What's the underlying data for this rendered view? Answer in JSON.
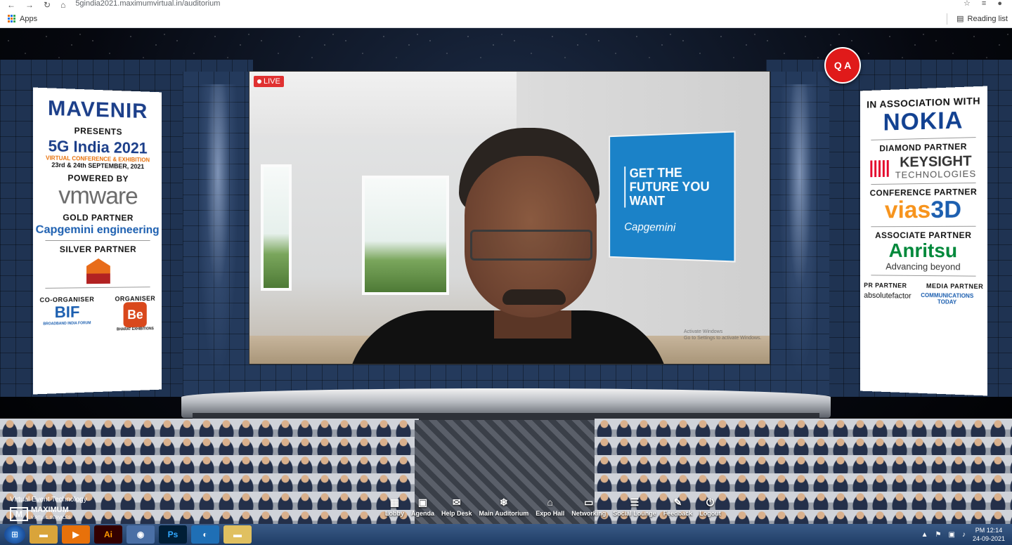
{
  "browser": {
    "url": "5gindia2021.maximumvirtual.in/auditorium",
    "bookmarks": {
      "apps_label": "Apps",
      "reading_list_label": "Reading list"
    }
  },
  "left_banner": {
    "sponsor_brand": "MAVENIR",
    "presents": "PRESENTS",
    "event_title": "5G India 2021",
    "event_subtitle": "VIRTUAL CONFERENCE & EXHIBITION",
    "event_dates": "23rd & 24th SEPTEMBER, 2021",
    "powered_by_label": "POWERED BY",
    "powered_by_brand": "vmware",
    "gold_label": "GOLD PARTNER",
    "gold_brand": "Capgemini engineering",
    "silver_label": "SILVER PARTNER",
    "coorganiser_label": "CO-ORGANISER",
    "coorganiser_brand": "BIF",
    "coorganiser_caption": "BROADBAND INDIA FORUM",
    "organiser_label": "ORGANISER",
    "organiser_brand": "Be",
    "organiser_caption": "BHARAT EXHIBITIONS"
  },
  "right_banner": {
    "association_label": "IN ASSOCIATION WITH",
    "association_brand": "NOKIA",
    "diamond_label": "DIAMOND PARTNER",
    "diamond_brand": "KEYSIGHT",
    "diamond_brand_sub": "TECHNOLOGIES",
    "conference_label": "CONFERENCE PARTNER",
    "conference_brand_a": "vias",
    "conference_brand_b": "3D",
    "associate_label": "ASSOCIATE PARTNER",
    "associate_brand": "Anritsu",
    "associate_tagline": "Advancing beyond",
    "pr_label": "PR PARTNER",
    "pr_brand": "absolutefactor",
    "media_label": "MEDIA PARTNER",
    "media_brand": "COMMUNICATIONS TODAY"
  },
  "video": {
    "live_label": "LIVE",
    "poster_line1": "GET THE FUTURE YOU WANT",
    "poster_brand": "Capgemini",
    "watermark_line1": "Activate Windows",
    "watermark_line2": "Go to Settings to activate Windows."
  },
  "qa_button": {
    "label": "Q A"
  },
  "brand": {
    "tagline": "Virtual Event Technology",
    "name": "MAXIMUM",
    "sub": "VIRTUAL SERVICES"
  },
  "nav": {
    "items": [
      {
        "label": "Lobby",
        "icon": "grid-icon"
      },
      {
        "label": "Agenda",
        "icon": "calendar-icon"
      },
      {
        "label": "Help Desk",
        "icon": "chat-icon"
      },
      {
        "label": "Main Auditorium",
        "icon": "snowflake-icon"
      },
      {
        "label": "Expo Hall",
        "icon": "building-icon"
      },
      {
        "label": "Networking",
        "icon": "card-icon"
      },
      {
        "label": "Social Lounge",
        "icon": "database-icon"
      },
      {
        "label": "Feedback",
        "icon": "edit-icon"
      },
      {
        "label": "Logout",
        "icon": "power-icon"
      }
    ]
  },
  "taskbar": {
    "apps": [
      "Ai",
      "Ps"
    ],
    "time": "PM 12:14",
    "date": "24-09-2021"
  }
}
